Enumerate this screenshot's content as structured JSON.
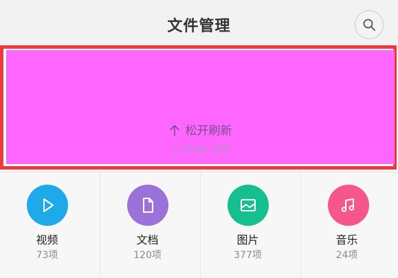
{
  "header": {
    "title": "文件管理",
    "search_icon": "search-icon"
  },
  "refresh": {
    "arrow_icon": "arrow-up-icon",
    "label": "松开刷新",
    "last_scan": "上次扫描: 刚刚"
  },
  "categories": [
    {
      "label": "视频",
      "count": "73项",
      "color": "#1ea9e8",
      "icon": "play-icon"
    },
    {
      "label": "文档",
      "count": "120项",
      "color": "#9b72d9",
      "icon": "document-icon"
    },
    {
      "label": "图片",
      "count": "377项",
      "color": "#15bf8f",
      "icon": "image-icon"
    },
    {
      "label": "音乐",
      "count": "24项",
      "color": "#f5568c",
      "icon": "music-note-icon"
    }
  ]
}
